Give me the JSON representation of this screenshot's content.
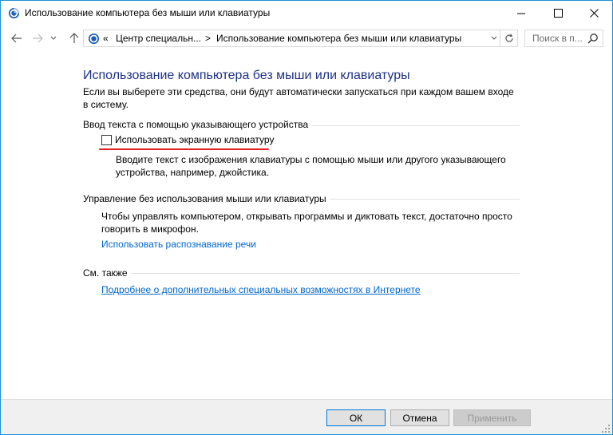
{
  "window": {
    "title": "Использование компьютера без мыши или клавиатуры",
    "minimize_glyph": "—",
    "maximize_glyph": "☐",
    "close_glyph": "✕"
  },
  "nav": {
    "back_glyph": "←",
    "forward_glyph": "→",
    "up_glyph": "↑"
  },
  "address": {
    "chevrons": "«",
    "breadcrumb_1": "Центр специальн...",
    "separator": ">",
    "breadcrumb_2": "Использование компьютера без мыши или клавиатуры"
  },
  "search": {
    "placeholder": "Поиск в п..."
  },
  "main": {
    "title": "Использование компьютера без мыши или клавиатуры",
    "intro": "Если вы выберете эти средства, они будут автоматически запускаться при каждом вашем входе в систему.",
    "section1": {
      "heading": "Ввод текста с помощью указывающего устройства",
      "checkbox_label": "Использовать экранную клавиатуру",
      "checkbox_checked": false,
      "description": "Вводите текст с изображения клавиатуры с помощью мыши или другого указывающего устройства, например, джойстика."
    },
    "section2": {
      "heading": "Управление без использования мыши или клавиатуры",
      "description": "Чтобы управлять компьютером, открывать программы и диктовать текст, достаточно просто говорить в микрофон.",
      "link": "Использовать распознавание речи"
    },
    "section3": {
      "heading": "См. также",
      "link": "Подробнее о дополнительных специальных возможностях в Интернете"
    }
  },
  "buttons": {
    "ok": "ОК",
    "cancel": "Отмена",
    "apply": "Применить"
  },
  "colors": {
    "title_blue": "#1e3287",
    "link_blue": "#0066cc",
    "highlight_red": "#e31e24",
    "window_border": "#1e90d6"
  },
  "icons": {
    "window": "ease-of-access-icon",
    "address": "ease-of-access-icon",
    "refresh": "refresh-icon",
    "search": "search-icon"
  }
}
